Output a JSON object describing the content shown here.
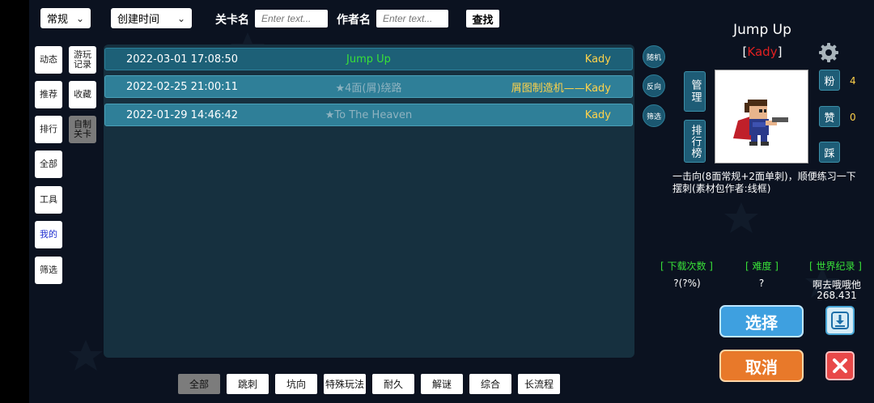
{
  "search": {
    "sort_mode": "常规",
    "sort_field": "创建时间",
    "level_name_label": "关卡名",
    "level_name_placeholder": "Enter text...",
    "author_label": "作者名",
    "author_placeholder": "Enter text...",
    "search_button": "查找"
  },
  "nav": {
    "items": [
      {
        "label": "动态"
      },
      {
        "label": "游玩记录"
      },
      {
        "label": "推荐"
      },
      {
        "label": "收藏"
      },
      {
        "label": "排行"
      },
      {
        "label": "自制关卡"
      },
      {
        "label": "全部"
      },
      {
        "label": "工具"
      },
      {
        "label": "我的"
      },
      {
        "label": "筛选"
      }
    ]
  },
  "levels": [
    {
      "date": "2022-03-01 17:08:50",
      "title": "Jump Up",
      "title_color": "#38e038",
      "author": "Kady"
    },
    {
      "date": "2022-02-25 21:00:11",
      "title": "★4面(屑)绕路",
      "title_color": "#8fb3c0",
      "author": "屑图制造机——Kady"
    },
    {
      "date": "2022-01-29 14:46:42",
      "title": "★To The Heaven",
      "title_color": "#8fb3c0",
      "author": "Kady"
    }
  ],
  "side_buttons": {
    "random": "随机",
    "reverse": "反向",
    "filter": "筛选"
  },
  "detail": {
    "title": "Jump Up",
    "author_open": "[",
    "author": "Kady",
    "author_close": "]",
    "manage_button": "管理",
    "leaderboard_button": "排行榜",
    "fans_label": "粉",
    "fans_count": "4",
    "like_label": "赞",
    "like_count": "0",
    "dislike_label": "踩",
    "description": "一击向(8面常规+2面单刺)，顺便练习一下摆刺(素材包作者:线框)",
    "stats": {
      "downloads_label": "[ 下载次数 ]",
      "downloads_value": "?(?%)",
      "difficulty_label": "[ 难度 ]",
      "difficulty_value": "?",
      "record_label": "[ 世界纪录 ]",
      "record_holder": "啊去哦哦他",
      "record_time": "268.431"
    },
    "select_button": "选择",
    "cancel_button": "取消"
  },
  "filters": {
    "tags": [
      "全部",
      "跳刺",
      "坑向",
      "特殊玩法",
      "耐久",
      "解谜",
      "综合",
      "长流程"
    ],
    "active": "全部"
  },
  "colors": {
    "panel": "#16303f",
    "row": "#2f7f98",
    "author": "#ffd24a",
    "accent_green": "#38e038",
    "author_red": "#e02020"
  }
}
